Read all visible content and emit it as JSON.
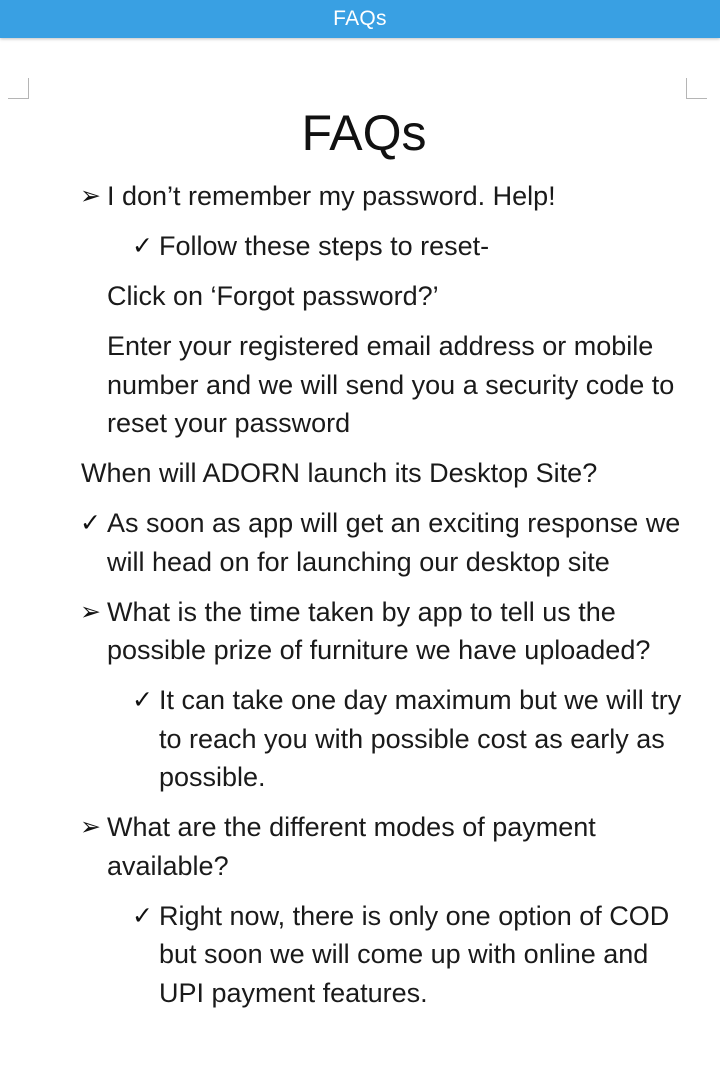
{
  "header": {
    "title": "FAQs"
  },
  "document": {
    "title": "FAQs",
    "q1": {
      "question": "I don’t remember my password. Help!",
      "answer": "Follow these steps to reset-",
      "step1": "Click on ‘Forgot password?’",
      "step2": "Enter your registered email address or mobile number and we will send you a security code to reset your password"
    },
    "q2": {
      "question": "When will ADORN launch its Desktop Site?",
      "answer": "As soon as app will get an exciting response we will head on for launching our desktop site"
    },
    "q3": {
      "question": "What is the time taken by app to tell us the possible prize of furniture we have uploaded?",
      "answer": "It can take one day maximum but we will try to reach you with possible cost as early as possible."
    },
    "q4": {
      "question": "What are the different modes of payment available?",
      "answer": "Right now, there is only one option of COD but soon we will come up with online and UPI payment features."
    },
    "icons": {
      "question": "arrow-bullet-icon",
      "answer": "checkmark-icon"
    }
  }
}
